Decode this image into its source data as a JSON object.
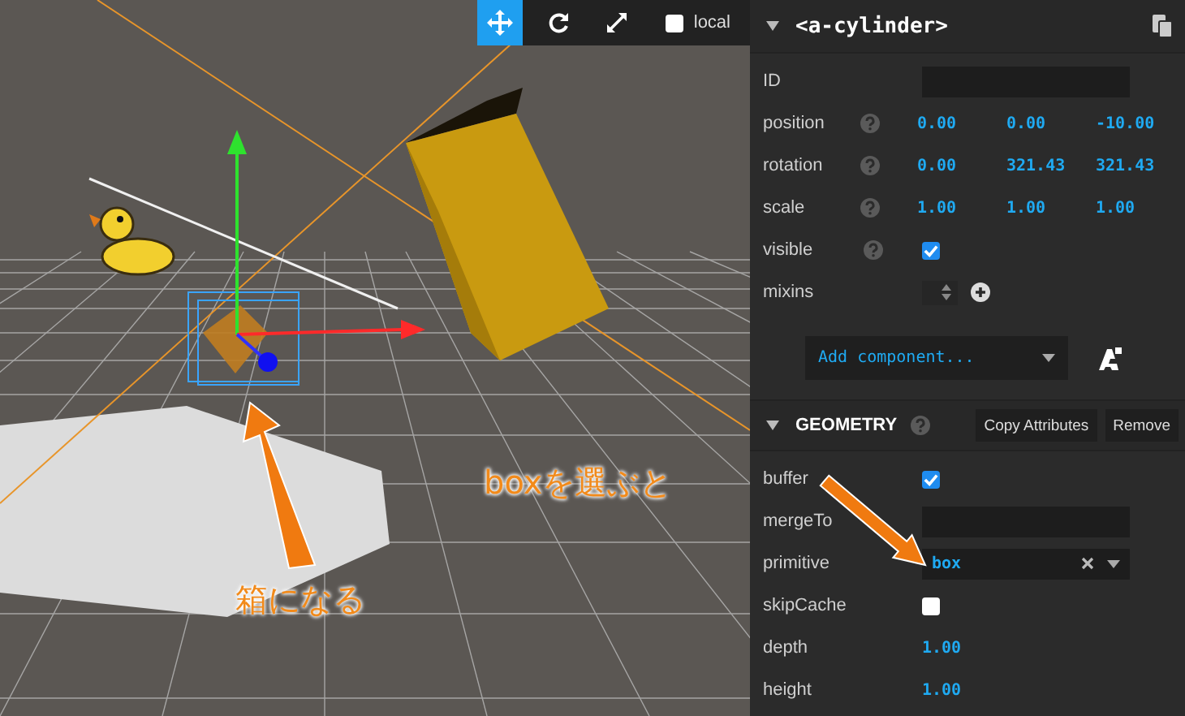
{
  "toolbar": {
    "tools": [
      {
        "kind": "translate",
        "selected": true
      },
      {
        "kind": "rotate",
        "selected": false
      },
      {
        "kind": "scale",
        "selected": false
      }
    ],
    "local": {
      "label": "local",
      "checked": false
    }
  },
  "annotations": [
    {
      "kind": "select",
      "text": "boxを選ぶと"
    },
    {
      "kind": "result",
      "text": "箱になる"
    }
  ],
  "entity": {
    "title": "<a-cylinder>",
    "expanded": true,
    "properties": [
      {
        "kind": "text",
        "label": "ID",
        "help": false
      },
      {
        "kind": "vec3",
        "label": "position",
        "help": true,
        "values": [
          "0.00",
          "0.00",
          "-10.00"
        ]
      },
      {
        "kind": "vec3",
        "label": "rotation",
        "help": true,
        "values": [
          "0.00",
          "321.43",
          "321.43"
        ]
      },
      {
        "kind": "vec3",
        "label": "scale",
        "help": true,
        "values": [
          "1.00",
          "1.00",
          "1.00"
        ]
      },
      {
        "kind": "checkbox",
        "label": "visible",
        "help": true,
        "checked": true
      },
      {
        "kind": "mixins",
        "label": "mixins",
        "help": false
      }
    ],
    "add_component": {
      "label": "Add component..."
    }
  },
  "geometry": {
    "title": "GEOMETRY",
    "expanded": true,
    "help": true,
    "buttons": [
      "Copy Attributes",
      "Remove"
    ],
    "properties": [
      {
        "kind": "checkbox",
        "label": "buffer",
        "checked": true
      },
      {
        "kind": "text",
        "label": "mergeTo"
      },
      {
        "kind": "select",
        "label": "primitive",
        "value": "box"
      },
      {
        "kind": "checkbox",
        "label": "skipCache",
        "checked": false
      },
      {
        "kind": "number",
        "label": "depth",
        "value": "1.00"
      },
      {
        "kind": "number",
        "label": "height",
        "value": "1.00"
      }
    ]
  }
}
